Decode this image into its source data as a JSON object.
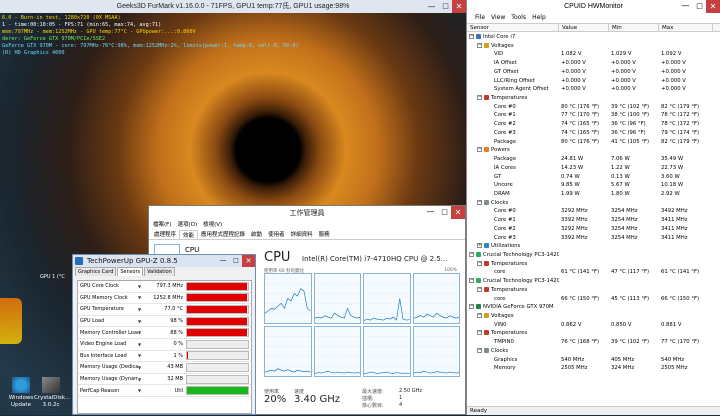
{
  "furmark": {
    "title": "Geeks3D FurMark v1.16.0.0 - 71FPS, GPU1 temp:77氏, GPU1 usage:98%",
    "min": "—",
    "max": "□",
    "close": "✕",
    "osd": [
      {
        "text": "6.0 - Burn-in test, 1280x720 (0X MSAA)",
        "color": "#ffd400"
      },
      {
        "text": "1 - time:00:10:05 - FPS:71 (min:65, max:74, avg:71)",
        "color": "#ffffff"
      },
      {
        "text": "mem:797MHz - mem:1252MHz - GPU temp:77°C - GPUpower:...:0.860V",
        "color": "#ffd400"
      },
      {
        "text": "derer: GeForce GTX 970M/PCIe/SSE2",
        "color": "#6ff06f"
      },
      {
        "text": "GeForce GTX 970M - core: 797MHz-76°C:98%, mem:1252MHz:2%, limits(power:1, temp:0, volt:0, OV:0)",
        "color": "#6fd8ff"
      },
      {
        "text": "(R) HD Graphics 4600",
        "color": "#6fd8ff"
      }
    ],
    "gpu_label": "GPU 1 (°C"
  },
  "desktop": {
    "icons": [
      {
        "name": "Windows Update",
        "line1": "Windows",
        "line2": "Update"
      },
      {
        "name": "CrystalDisk",
        "line1": "CrystalDisk...",
        "line2": "3.0.2c"
      }
    ]
  },
  "hwmonitor": {
    "title": "CPUID HWMonitor",
    "min": "—",
    "max": "□",
    "close": "✕",
    "menu": [
      "File",
      "View",
      "Tools",
      "Help"
    ],
    "columns": [
      "Sensor",
      "Value",
      "Min",
      "Max"
    ],
    "status": "Ready",
    "rows": [
      {
        "indent": 0,
        "exp": "−",
        "icon": "#3c6fb4",
        "label": "Intel Core i7",
        "v": "",
        "mn": "",
        "mx": ""
      },
      {
        "indent": 1,
        "exp": "−",
        "icon": "#d4a017",
        "label": "Voltages",
        "v": "",
        "mn": "",
        "mx": ""
      },
      {
        "indent": 2,
        "label": "VID",
        "v": "1.082 V",
        "mn": "1.029 V",
        "mx": "1.092 V"
      },
      {
        "indent": 2,
        "label": "IA Offset",
        "v": "+0.000 V",
        "mn": "+0.000 V",
        "mx": "+0.000 V"
      },
      {
        "indent": 2,
        "label": "GT Offset",
        "v": "+0.000 V",
        "mn": "+0.000 V",
        "mx": "+0.000 V"
      },
      {
        "indent": 2,
        "label": "LLC/Ring Offset",
        "v": "+0.000 V",
        "mn": "+0.000 V",
        "mx": "+0.000 V"
      },
      {
        "indent": 2,
        "label": "System Agent Offset",
        "v": "+0.000 V",
        "mn": "+0.000 V",
        "mx": "+0.000 V"
      },
      {
        "indent": 1,
        "exp": "−",
        "icon": "#c0392b",
        "label": "Temperatures",
        "v": "",
        "mn": "",
        "mx": ""
      },
      {
        "indent": 2,
        "label": "Core #0",
        "v": "80 °C (176 °F)",
        "mn": "39 °C (102 °F)",
        "mx": "82 °C (179 °F)"
      },
      {
        "indent": 2,
        "label": "Core #1",
        "v": "77 °C (170 °F)",
        "mn": "38 °C (100 °F)",
        "mx": "78 °C (172 °F)"
      },
      {
        "indent": 2,
        "label": "Core #2",
        "v": "74 °C (165 °F)",
        "mn": "36 °C (96 °F)",
        "mx": "78 °C (172 °F)"
      },
      {
        "indent": 2,
        "label": "Core #3",
        "v": "74 °C (165 °F)",
        "mn": "36 °C (96 °F)",
        "mx": "79 °C (174 °F)"
      },
      {
        "indent": 2,
        "label": "Package",
        "v": "80 °C (176 °F)",
        "mn": "41 °C (105 °F)",
        "mx": "82 °C (179 °F)"
      },
      {
        "indent": 1,
        "exp": "−",
        "icon": "#e67e22",
        "label": "Powers",
        "v": "",
        "mn": "",
        "mx": ""
      },
      {
        "indent": 2,
        "label": "Package",
        "v": "24.81 W",
        "mn": "7.06 W",
        "mx": "35.49 W"
      },
      {
        "indent": 2,
        "label": "IA Cores",
        "v": "14.23 W",
        "mn": "1.22 W",
        "mx": "22.73 W"
      },
      {
        "indent": 2,
        "label": "GT",
        "v": "0.74 W",
        "mn": "0.13 W",
        "mx": "3.60 W"
      },
      {
        "indent": 2,
        "label": "Uncore",
        "v": "9.85 W",
        "mn": "5.67 W",
        "mx": "10.18 W"
      },
      {
        "indent": 2,
        "label": "DRAM",
        "v": "1.99 W",
        "mn": "1.80 W",
        "mx": "2.92 W"
      },
      {
        "indent": 1,
        "exp": "−",
        "icon": "#7f8c8d",
        "label": "Clocks",
        "v": "",
        "mn": "",
        "mx": ""
      },
      {
        "indent": 2,
        "label": "Core #0",
        "v": "3292 MHz",
        "mn": "3254 MHz",
        "mx": "3492 MHz"
      },
      {
        "indent": 2,
        "label": "Core #1",
        "v": "3392 MHz",
        "mn": "3254 MHz",
        "mx": "3411 MHz"
      },
      {
        "indent": 2,
        "label": "Core #2",
        "v": "3292 MHz",
        "mn": "3254 MHz",
        "mx": "3411 MHz"
      },
      {
        "indent": 2,
        "label": "Core #3",
        "v": "3392 MHz",
        "mn": "3254 MHz",
        "mx": "3411 MHz"
      },
      {
        "indent": 1,
        "exp": "+",
        "icon": "#2e86c1",
        "label": "Utilizations",
        "v": "",
        "mn": "",
        "mx": ""
      },
      {
        "indent": 0,
        "exp": "−",
        "icon": "#27ae60",
        "label": "Crucial Technology PC3-14200",
        "v": "",
        "mn": "",
        "mx": ""
      },
      {
        "indent": 1,
        "exp": "−",
        "icon": "#c0392b",
        "label": "Temperatures",
        "v": "",
        "mn": "",
        "mx": ""
      },
      {
        "indent": 2,
        "label": "core",
        "v": "61 °C (141 °F)",
        "mn": "47 °C (117 °F)",
        "mx": "61 °C (141 °F)"
      },
      {
        "indent": 0,
        "exp": "−",
        "icon": "#27ae60",
        "label": "Crucial Technology PC3-14200",
        "v": "",
        "mn": "",
        "mx": ""
      },
      {
        "indent": 1,
        "exp": "−",
        "icon": "#c0392b",
        "label": "Temperatures",
        "v": "",
        "mn": "",
        "mx": ""
      },
      {
        "indent": 2,
        "label": "core",
        "v": "66 °C (150 °F)",
        "mn": "45 °C (113 °F)",
        "mx": "66 °C (150 °F)"
      },
      {
        "indent": 0,
        "exp": "−",
        "icon": "#1e8449",
        "label": "NVIDIA GeForce GTX 970M",
        "v": "",
        "mn": "",
        "mx": ""
      },
      {
        "indent": 1,
        "exp": "−",
        "icon": "#d4a017",
        "label": "Voltages",
        "v": "",
        "mn": "",
        "mx": ""
      },
      {
        "indent": 2,
        "label": "VIN0",
        "v": "0.862 V",
        "mn": "0.850 V",
        "mx": "0.881 V"
      },
      {
        "indent": 1,
        "exp": "−",
        "icon": "#c0392b",
        "label": "Temperatures",
        "v": "",
        "mn": "",
        "mx": ""
      },
      {
        "indent": 2,
        "label": "TMPIN0",
        "v": "76 °C (168 °F)",
        "mn": "39 °C (102 °F)",
        "mx": "77 °C (170 °F)"
      },
      {
        "indent": 1,
        "exp": "−",
        "icon": "#7f8c8d",
        "label": "Clocks",
        "v": "",
        "mn": "",
        "mx": ""
      },
      {
        "indent": 2,
        "label": "Graphics",
        "v": "540 MHz",
        "mn": "405 MHz",
        "mx": "540 MHz"
      },
      {
        "indent": 2,
        "label": "Memory",
        "v": "2505 MHz",
        "mn": "324 MHz",
        "mx": "2505 MHz"
      }
    ]
  },
  "taskmgr": {
    "title": "工作管理員",
    "min": "—",
    "max": "□",
    "close": "✕",
    "menu": [
      "檔案(F)",
      "選項(O)",
      "檢視(V)"
    ],
    "tabs": [
      "處理程序",
      "效能",
      "應用程式歷程記錄",
      "啟動",
      "使用者",
      "詳細資料",
      "服務"
    ],
    "side_label": "CPU",
    "big_label": "CPU",
    "cpu_name": "Intel(R) Core(TM) i7-4710HQ CPU @ 2.5...",
    "sub_label": "使用率 60 秒的變化",
    "pct_label": "100%",
    "usage_label": "使用率",
    "usage_value": "20%",
    "speed_label": "速度",
    "speed_value": "3.40 GHz",
    "base_label": "最大速度:",
    "base_value": "2.50 GHz",
    "sockets_label": "插槽:",
    "sockets_value": "1",
    "cores_label": "核心數目:",
    "cores_value": "4"
  },
  "gpuz": {
    "title": "TechPowerUp GPU-Z 0.8.5",
    "min": "—",
    "max": "□",
    "close": "✕",
    "tabs": [
      "Graphics Card",
      "Sensors",
      "Validation"
    ],
    "sensors": [
      {
        "label": "GPU Core Clock",
        "value": "797.3 MHz",
        "level": 0.98,
        "color": "#e00000"
      },
      {
        "label": "GPU Memory Clock",
        "value": "1252.8 MHz",
        "level": 0.98,
        "color": "#e00000"
      },
      {
        "label": "GPU Temperature",
        "value": "77.0 °C",
        "level": 0.98,
        "color": "#e00000"
      },
      {
        "label": "GPU Load",
        "value": "98 %",
        "level": 0.98,
        "color": "#e00000"
      },
      {
        "label": "Memory Controller Load",
        "value": "88 %",
        "level": 0.98,
        "color": "#e00000"
      },
      {
        "label": "Video Engine Load",
        "value": "0 %",
        "level": 0,
        "color": "#e00000"
      },
      {
        "label": "Bus Interface Load",
        "value": "1 %",
        "level": 0.02,
        "color": "#e00000"
      },
      {
        "label": "Memory Usage (Dedicated)",
        "value": "43 MB",
        "level": 0,
        "color": "#e00000"
      },
      {
        "label": "Memory Usage (Dynamic)",
        "value": "32 MB",
        "level": 0,
        "color": "#e00000"
      },
      {
        "label": "PerfCap Reason",
        "value": "Util",
        "level": 1,
        "color": "#19b619"
      }
    ]
  }
}
